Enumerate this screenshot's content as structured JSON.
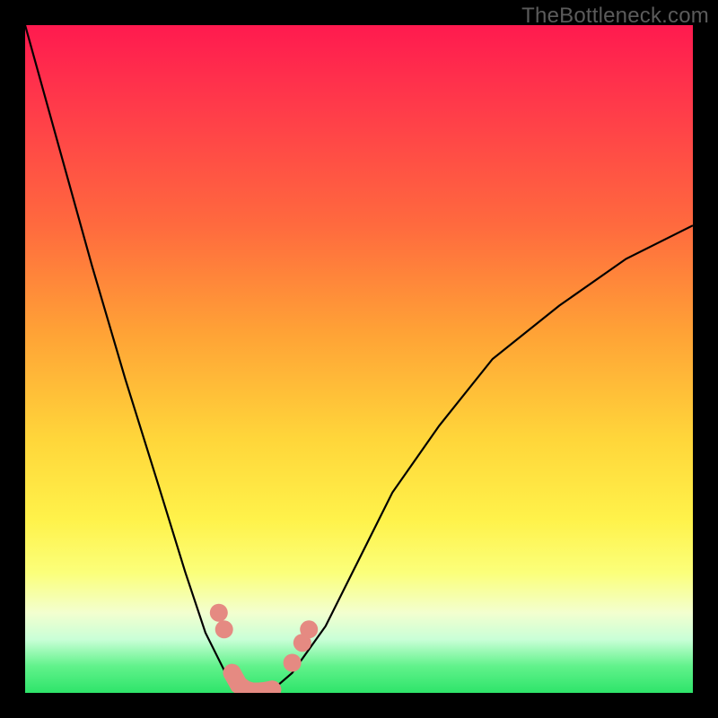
{
  "watermark": "TheBottleneck.com",
  "chart_data": {
    "type": "line",
    "title": "",
    "xlabel": "",
    "ylabel": "",
    "xlim": [
      0,
      100
    ],
    "ylim": [
      0,
      100
    ],
    "grid": false,
    "series": [
      {
        "name": "bottleneck-curve",
        "x": [
          0,
          5,
          10,
          15,
          20,
          24,
          27,
          30,
          32,
          33.5,
          35,
          37,
          40,
          45,
          50,
          55,
          62,
          70,
          80,
          90,
          100
        ],
        "y": [
          100,
          82,
          64,
          47,
          31,
          18,
          9,
          3,
          0.6,
          0,
          0,
          0.4,
          3,
          10,
          20,
          30,
          40,
          50,
          58,
          65,
          70
        ]
      }
    ],
    "markers": {
      "name": "highlight-band",
      "color": "#e58a82",
      "points": [
        {
          "x": 29.0,
          "y": 12.0
        },
        {
          "x": 29.8,
          "y": 9.5
        },
        {
          "x": 31.0,
          "y": 3.0
        },
        {
          "x": 32.0,
          "y": 1.2
        },
        {
          "x": 33.0,
          "y": 0.5
        },
        {
          "x": 34.0,
          "y": 0.2
        },
        {
          "x": 35.0,
          "y": 0.2
        },
        {
          "x": 36.0,
          "y": 0.3
        },
        {
          "x": 37.0,
          "y": 0.5
        },
        {
          "x": 40.0,
          "y": 4.5
        },
        {
          "x": 41.5,
          "y": 7.5
        },
        {
          "x": 42.5,
          "y": 9.5
        }
      ]
    },
    "gradient_stops": [
      {
        "pos": 0.0,
        "color": "#ff1a4f"
      },
      {
        "pos": 0.3,
        "color": "#ff6a3e"
      },
      {
        "pos": 0.62,
        "color": "#ffd63a"
      },
      {
        "pos": 0.82,
        "color": "#fbff7a"
      },
      {
        "pos": 0.92,
        "color": "#c9ffd7"
      },
      {
        "pos": 1.0,
        "color": "#2ee46a"
      }
    ]
  }
}
